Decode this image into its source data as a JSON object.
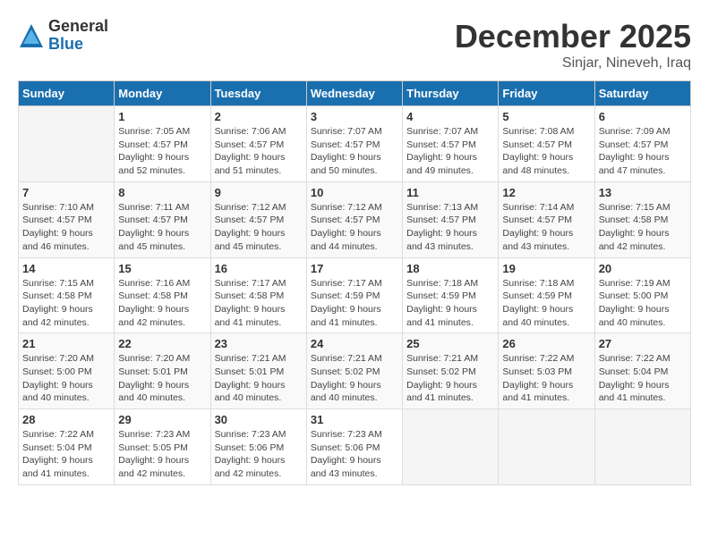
{
  "logo": {
    "general": "General",
    "blue": "Blue"
  },
  "title": "December 2025",
  "location": "Sinjar, Nineveh, Iraq",
  "days_of_week": [
    "Sunday",
    "Monday",
    "Tuesday",
    "Wednesday",
    "Thursday",
    "Friday",
    "Saturday"
  ],
  "weeks": [
    [
      {
        "day": "",
        "sunrise": "",
        "sunset": "",
        "daylight": ""
      },
      {
        "day": "1",
        "sunrise": "Sunrise: 7:05 AM",
        "sunset": "Sunset: 4:57 PM",
        "daylight": "Daylight: 9 hours and 52 minutes."
      },
      {
        "day": "2",
        "sunrise": "Sunrise: 7:06 AM",
        "sunset": "Sunset: 4:57 PM",
        "daylight": "Daylight: 9 hours and 51 minutes."
      },
      {
        "day": "3",
        "sunrise": "Sunrise: 7:07 AM",
        "sunset": "Sunset: 4:57 PM",
        "daylight": "Daylight: 9 hours and 50 minutes."
      },
      {
        "day": "4",
        "sunrise": "Sunrise: 7:07 AM",
        "sunset": "Sunset: 4:57 PM",
        "daylight": "Daylight: 9 hours and 49 minutes."
      },
      {
        "day": "5",
        "sunrise": "Sunrise: 7:08 AM",
        "sunset": "Sunset: 4:57 PM",
        "daylight": "Daylight: 9 hours and 48 minutes."
      },
      {
        "day": "6",
        "sunrise": "Sunrise: 7:09 AM",
        "sunset": "Sunset: 4:57 PM",
        "daylight": "Daylight: 9 hours and 47 minutes."
      }
    ],
    [
      {
        "day": "7",
        "sunrise": "Sunrise: 7:10 AM",
        "sunset": "Sunset: 4:57 PM",
        "daylight": "Daylight: 9 hours and 46 minutes."
      },
      {
        "day": "8",
        "sunrise": "Sunrise: 7:11 AM",
        "sunset": "Sunset: 4:57 PM",
        "daylight": "Daylight: 9 hours and 45 minutes."
      },
      {
        "day": "9",
        "sunrise": "Sunrise: 7:12 AM",
        "sunset": "Sunset: 4:57 PM",
        "daylight": "Daylight: 9 hours and 45 minutes."
      },
      {
        "day": "10",
        "sunrise": "Sunrise: 7:12 AM",
        "sunset": "Sunset: 4:57 PM",
        "daylight": "Daylight: 9 hours and 44 minutes."
      },
      {
        "day": "11",
        "sunrise": "Sunrise: 7:13 AM",
        "sunset": "Sunset: 4:57 PM",
        "daylight": "Daylight: 9 hours and 43 minutes."
      },
      {
        "day": "12",
        "sunrise": "Sunrise: 7:14 AM",
        "sunset": "Sunset: 4:57 PM",
        "daylight": "Daylight: 9 hours and 43 minutes."
      },
      {
        "day": "13",
        "sunrise": "Sunrise: 7:15 AM",
        "sunset": "Sunset: 4:58 PM",
        "daylight": "Daylight: 9 hours and 42 minutes."
      }
    ],
    [
      {
        "day": "14",
        "sunrise": "Sunrise: 7:15 AM",
        "sunset": "Sunset: 4:58 PM",
        "daylight": "Daylight: 9 hours and 42 minutes."
      },
      {
        "day": "15",
        "sunrise": "Sunrise: 7:16 AM",
        "sunset": "Sunset: 4:58 PM",
        "daylight": "Daylight: 9 hours and 42 minutes."
      },
      {
        "day": "16",
        "sunrise": "Sunrise: 7:17 AM",
        "sunset": "Sunset: 4:58 PM",
        "daylight": "Daylight: 9 hours and 41 minutes."
      },
      {
        "day": "17",
        "sunrise": "Sunrise: 7:17 AM",
        "sunset": "Sunset: 4:59 PM",
        "daylight": "Daylight: 9 hours and 41 minutes."
      },
      {
        "day": "18",
        "sunrise": "Sunrise: 7:18 AM",
        "sunset": "Sunset: 4:59 PM",
        "daylight": "Daylight: 9 hours and 41 minutes."
      },
      {
        "day": "19",
        "sunrise": "Sunrise: 7:18 AM",
        "sunset": "Sunset: 4:59 PM",
        "daylight": "Daylight: 9 hours and 40 minutes."
      },
      {
        "day": "20",
        "sunrise": "Sunrise: 7:19 AM",
        "sunset": "Sunset: 5:00 PM",
        "daylight": "Daylight: 9 hours and 40 minutes."
      }
    ],
    [
      {
        "day": "21",
        "sunrise": "Sunrise: 7:20 AM",
        "sunset": "Sunset: 5:00 PM",
        "daylight": "Daylight: 9 hours and 40 minutes."
      },
      {
        "day": "22",
        "sunrise": "Sunrise: 7:20 AM",
        "sunset": "Sunset: 5:01 PM",
        "daylight": "Daylight: 9 hours and 40 minutes."
      },
      {
        "day": "23",
        "sunrise": "Sunrise: 7:21 AM",
        "sunset": "Sunset: 5:01 PM",
        "daylight": "Daylight: 9 hours and 40 minutes."
      },
      {
        "day": "24",
        "sunrise": "Sunrise: 7:21 AM",
        "sunset": "Sunset: 5:02 PM",
        "daylight": "Daylight: 9 hours and 40 minutes."
      },
      {
        "day": "25",
        "sunrise": "Sunrise: 7:21 AM",
        "sunset": "Sunset: 5:02 PM",
        "daylight": "Daylight: 9 hours and 41 minutes."
      },
      {
        "day": "26",
        "sunrise": "Sunrise: 7:22 AM",
        "sunset": "Sunset: 5:03 PM",
        "daylight": "Daylight: 9 hours and 41 minutes."
      },
      {
        "day": "27",
        "sunrise": "Sunrise: 7:22 AM",
        "sunset": "Sunset: 5:04 PM",
        "daylight": "Daylight: 9 hours and 41 minutes."
      }
    ],
    [
      {
        "day": "28",
        "sunrise": "Sunrise: 7:22 AM",
        "sunset": "Sunset: 5:04 PM",
        "daylight": "Daylight: 9 hours and 41 minutes."
      },
      {
        "day": "29",
        "sunrise": "Sunrise: 7:23 AM",
        "sunset": "Sunset: 5:05 PM",
        "daylight": "Daylight: 9 hours and 42 minutes."
      },
      {
        "day": "30",
        "sunrise": "Sunrise: 7:23 AM",
        "sunset": "Sunset: 5:06 PM",
        "daylight": "Daylight: 9 hours and 42 minutes."
      },
      {
        "day": "31",
        "sunrise": "Sunrise: 7:23 AM",
        "sunset": "Sunset: 5:06 PM",
        "daylight": "Daylight: 9 hours and 43 minutes."
      },
      {
        "day": "",
        "sunrise": "",
        "sunset": "",
        "daylight": ""
      },
      {
        "day": "",
        "sunrise": "",
        "sunset": "",
        "daylight": ""
      },
      {
        "day": "",
        "sunrise": "",
        "sunset": "",
        "daylight": ""
      }
    ]
  ]
}
